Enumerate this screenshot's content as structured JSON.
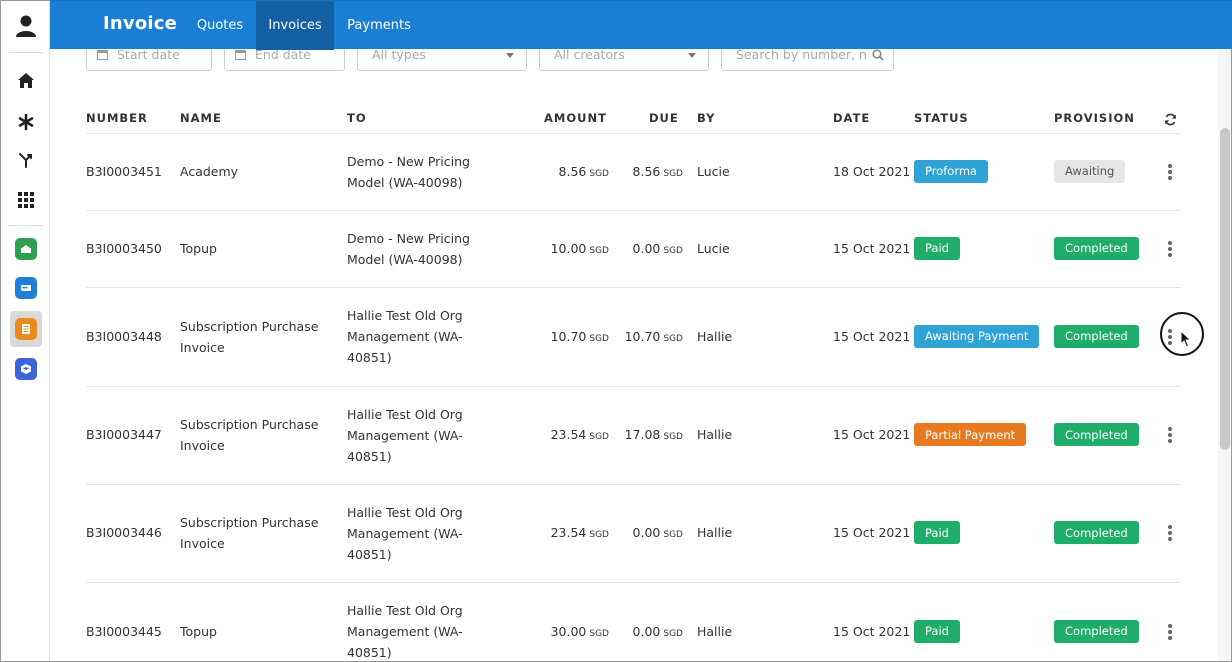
{
  "header": {
    "brand": "Invoice",
    "tabs": [
      {
        "label": "Quotes",
        "active": false
      },
      {
        "label": "Invoices",
        "active": true
      },
      {
        "label": "Payments",
        "active": false
      }
    ],
    "accent": "#1a7fd4"
  },
  "filters": {
    "start_date_placeholder": "Start date",
    "end_date_placeholder": "End date",
    "type_placeholder": "All types",
    "creator_placeholder": "All creators",
    "search_placeholder": "Search by number, n"
  },
  "table": {
    "columns": [
      "NUMBER",
      "NAME",
      "TO",
      "AMOUNT",
      "DUE",
      "BY",
      "DATE",
      "STATUS",
      "PROVISION"
    ],
    "rows": [
      {
        "number": "B3I0003451",
        "name": [
          "Academy"
        ],
        "to": [
          "Demo - New Pricing",
          "Model (WA-40098)"
        ],
        "amount": "8.56",
        "amount_cur": "SGD",
        "due": "8.56",
        "due_cur": "SGD",
        "by": "Lucie",
        "date": "18 Oct 2021",
        "status": "Proforma",
        "status_color": "#2fa3d6",
        "provision": "Awaiting",
        "provision_color": "#e6e6e6"
      },
      {
        "number": "B3I0003450",
        "name": [
          "Topup"
        ],
        "to": [
          "Demo - New Pricing",
          "Model (WA-40098)"
        ],
        "amount": "10.00",
        "amount_cur": "SGD",
        "due": "0.00",
        "due_cur": "SGD",
        "by": "Lucie",
        "date": "15 Oct 2021",
        "status": "Paid",
        "status_color": "#1fad6a",
        "provision": "Completed",
        "provision_color": "#1fad6a"
      },
      {
        "number": "B3I0003448",
        "name": [
          "Subscription Purchase",
          "Invoice"
        ],
        "to": [
          "Hallie Test Old Org",
          "Management (WA-",
          "40851)"
        ],
        "amount": "10.70",
        "amount_cur": "SGD",
        "due": "10.70",
        "due_cur": "SGD",
        "by": "Hallie",
        "date": "15 Oct 2021",
        "status": "Awaiting Payment",
        "status_color": "#2fa3d6",
        "provision": "Completed",
        "provision_color": "#1fad6a"
      },
      {
        "number": "B3I0003447",
        "name": [
          "Subscription Purchase",
          "Invoice"
        ],
        "to": [
          "Hallie Test Old Org",
          "Management (WA-",
          "40851)"
        ],
        "amount": "23.54",
        "amount_cur": "SGD",
        "due": "17.08",
        "due_cur": "SGD",
        "by": "Hallie",
        "date": "15 Oct 2021",
        "status": "Partial Payment",
        "status_color": "#e8791f",
        "provision": "Completed",
        "provision_color": "#1fad6a"
      },
      {
        "number": "B3I0003446",
        "name": [
          "Subscription Purchase",
          "Invoice"
        ],
        "to": [
          "Hallie Test Old Org",
          "Management (WA-",
          "40851)"
        ],
        "amount": "23.54",
        "amount_cur": "SGD",
        "due": "0.00",
        "due_cur": "SGD",
        "by": "Hallie",
        "date": "15 Oct 2021",
        "status": "Paid",
        "status_color": "#1fad6a",
        "provision": "Completed",
        "provision_color": "#1fad6a"
      },
      {
        "number": "B3I0003445",
        "name": [
          "Topup"
        ],
        "to": [
          "Hallie Test Old Org",
          "Management (WA-",
          "40851)"
        ],
        "amount": "30.00",
        "amount_cur": "SGD",
        "due": "0.00",
        "due_cur": "SGD",
        "by": "Hallie",
        "date": "15 Oct 2021",
        "status": "Paid",
        "status_color": "#1fad6a",
        "provision": "Completed",
        "provision_color": "#1fad6a"
      }
    ]
  },
  "sidebar": {
    "icons": [
      "user-icon",
      "home-icon",
      "asterisk-icon",
      "merge-icon",
      "apps-grid-icon",
      "app-green-icon",
      "app-blue-icon",
      "app-invoice-icon",
      "app-package-icon"
    ]
  }
}
